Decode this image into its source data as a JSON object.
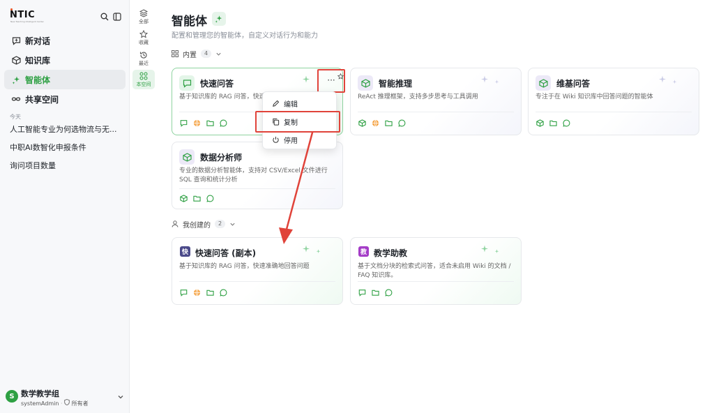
{
  "brand": {
    "logo": "NTIC",
    "tagline": "New Teaching Intelligent Center"
  },
  "nav": [
    {
      "label": "新对话",
      "icon": "chat-plus-icon",
      "active": false
    },
    {
      "label": "知识库",
      "icon": "cube-icon",
      "active": false
    },
    {
      "label": "智能体",
      "icon": "sparkle-icon",
      "active": true
    },
    {
      "label": "共享空间",
      "icon": "infinity-icon",
      "active": false
    }
  ],
  "history": {
    "section": "今天",
    "items": [
      "人工智能专业为何选物流与无...",
      "中职AI数智化申报条件",
      "询问项目数量"
    ]
  },
  "user": {
    "avatar": "S",
    "name": "数学教学组",
    "account": "systemAdmin",
    "role": "所有者"
  },
  "filters": [
    {
      "label": "全部",
      "icon": "layers-icon",
      "active": false
    },
    {
      "label": "收藏",
      "icon": "star-icon",
      "active": false
    },
    {
      "label": "最近",
      "icon": "history-icon",
      "active": false
    },
    {
      "label": "本空间",
      "icon": "grid-icon",
      "active": true
    }
  ],
  "page": {
    "title": "智能体",
    "description": "配置和管理您的智能体，自定义对话行为和能力"
  },
  "groups": [
    {
      "label": "内置",
      "count": "4",
      "cards": [
        {
          "title": "快速问答",
          "description": "基于知识库的 RAG 问答，快速准",
          "icon": "chat-icon",
          "tools": [
            "chat-icon",
            "globe-icon",
            "folder-icon",
            "bubble-icon"
          ]
        },
        {
          "title": "智能推理",
          "description": "ReAct 推理框架，支持多步思考与工具调用",
          "icon": "cube-icon",
          "tools": [
            "cube-icon",
            "globe-icon",
            "folder-icon",
            "bubble-icon"
          ]
        },
        {
          "title": "维基问答",
          "description": "专注于在 Wiki 知识库中回答问题的智能体",
          "icon": "cube-icon",
          "tools": [
            "cube-icon",
            "folder-icon",
            "bubble-icon"
          ]
        },
        {
          "title": "数据分析师",
          "description": "专业的数据分析智能体，支持对 CSV/Excel 文件进行 SQL 查询和统计分析",
          "icon": "cube-icon",
          "tools": [
            "cube-icon",
            "folder-icon",
            "bubble-icon"
          ]
        }
      ]
    },
    {
      "label": "我创建的",
      "count": "2",
      "cards": [
        {
          "title": "快速问答 (副本)",
          "badge": "快",
          "description": "基于知识库的 RAG 问答，快速准确地回答问题",
          "tools": [
            "chat-icon",
            "globe-icon",
            "folder-icon",
            "bubble-icon"
          ]
        },
        {
          "title": "教学助教",
          "badge": "教",
          "description": "基于文档分块的检索式问答，适合未启用 Wiki 的文档 / FAQ 知识库。",
          "tools": [
            "chat-icon",
            "folder-icon",
            "bubble-icon"
          ]
        }
      ]
    }
  ],
  "card_menu": {
    "more": "···",
    "items": [
      {
        "label": "编辑",
        "icon": "pencil-icon"
      },
      {
        "label": "复制",
        "icon": "copy-icon"
      },
      {
        "label": "停用",
        "icon": "power-icon"
      }
    ]
  },
  "colors": {
    "accent": "#2ea043",
    "annotation": "#e0433a",
    "badge_dark": "#4b4a8a",
    "badge_violet": "#a43cc7"
  }
}
